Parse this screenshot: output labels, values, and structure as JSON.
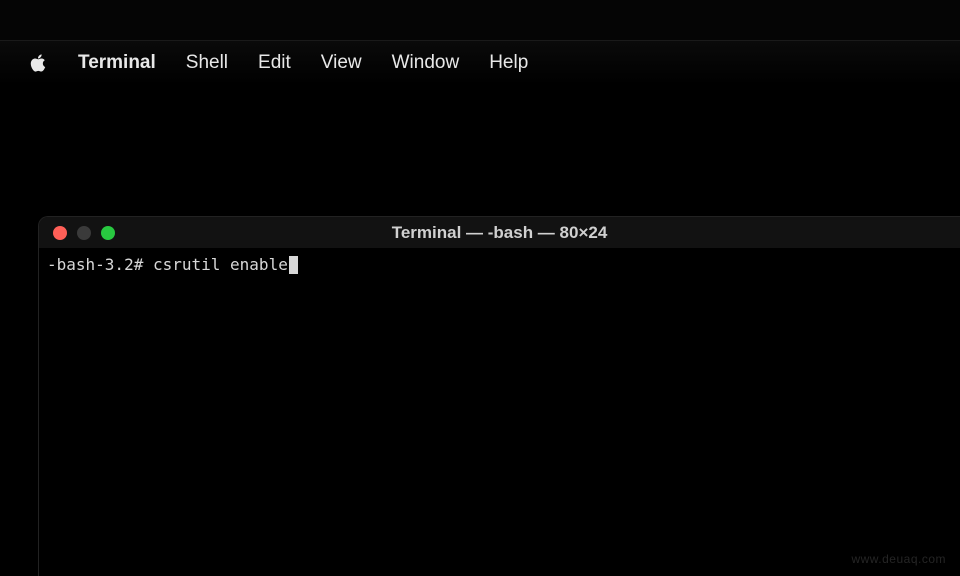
{
  "menubar": {
    "items": [
      {
        "label": "Terminal",
        "bold": true
      },
      {
        "label": "Shell",
        "bold": false
      },
      {
        "label": "Edit",
        "bold": false
      },
      {
        "label": "View",
        "bold": false
      },
      {
        "label": "Window",
        "bold": false
      },
      {
        "label": "Help",
        "bold": false
      }
    ]
  },
  "terminal": {
    "window_title": "Terminal — -bash — 80×24",
    "prompt": "-bash-3.2# ",
    "command": "csrutil enable"
  },
  "watermark": "www.deuaq.com"
}
